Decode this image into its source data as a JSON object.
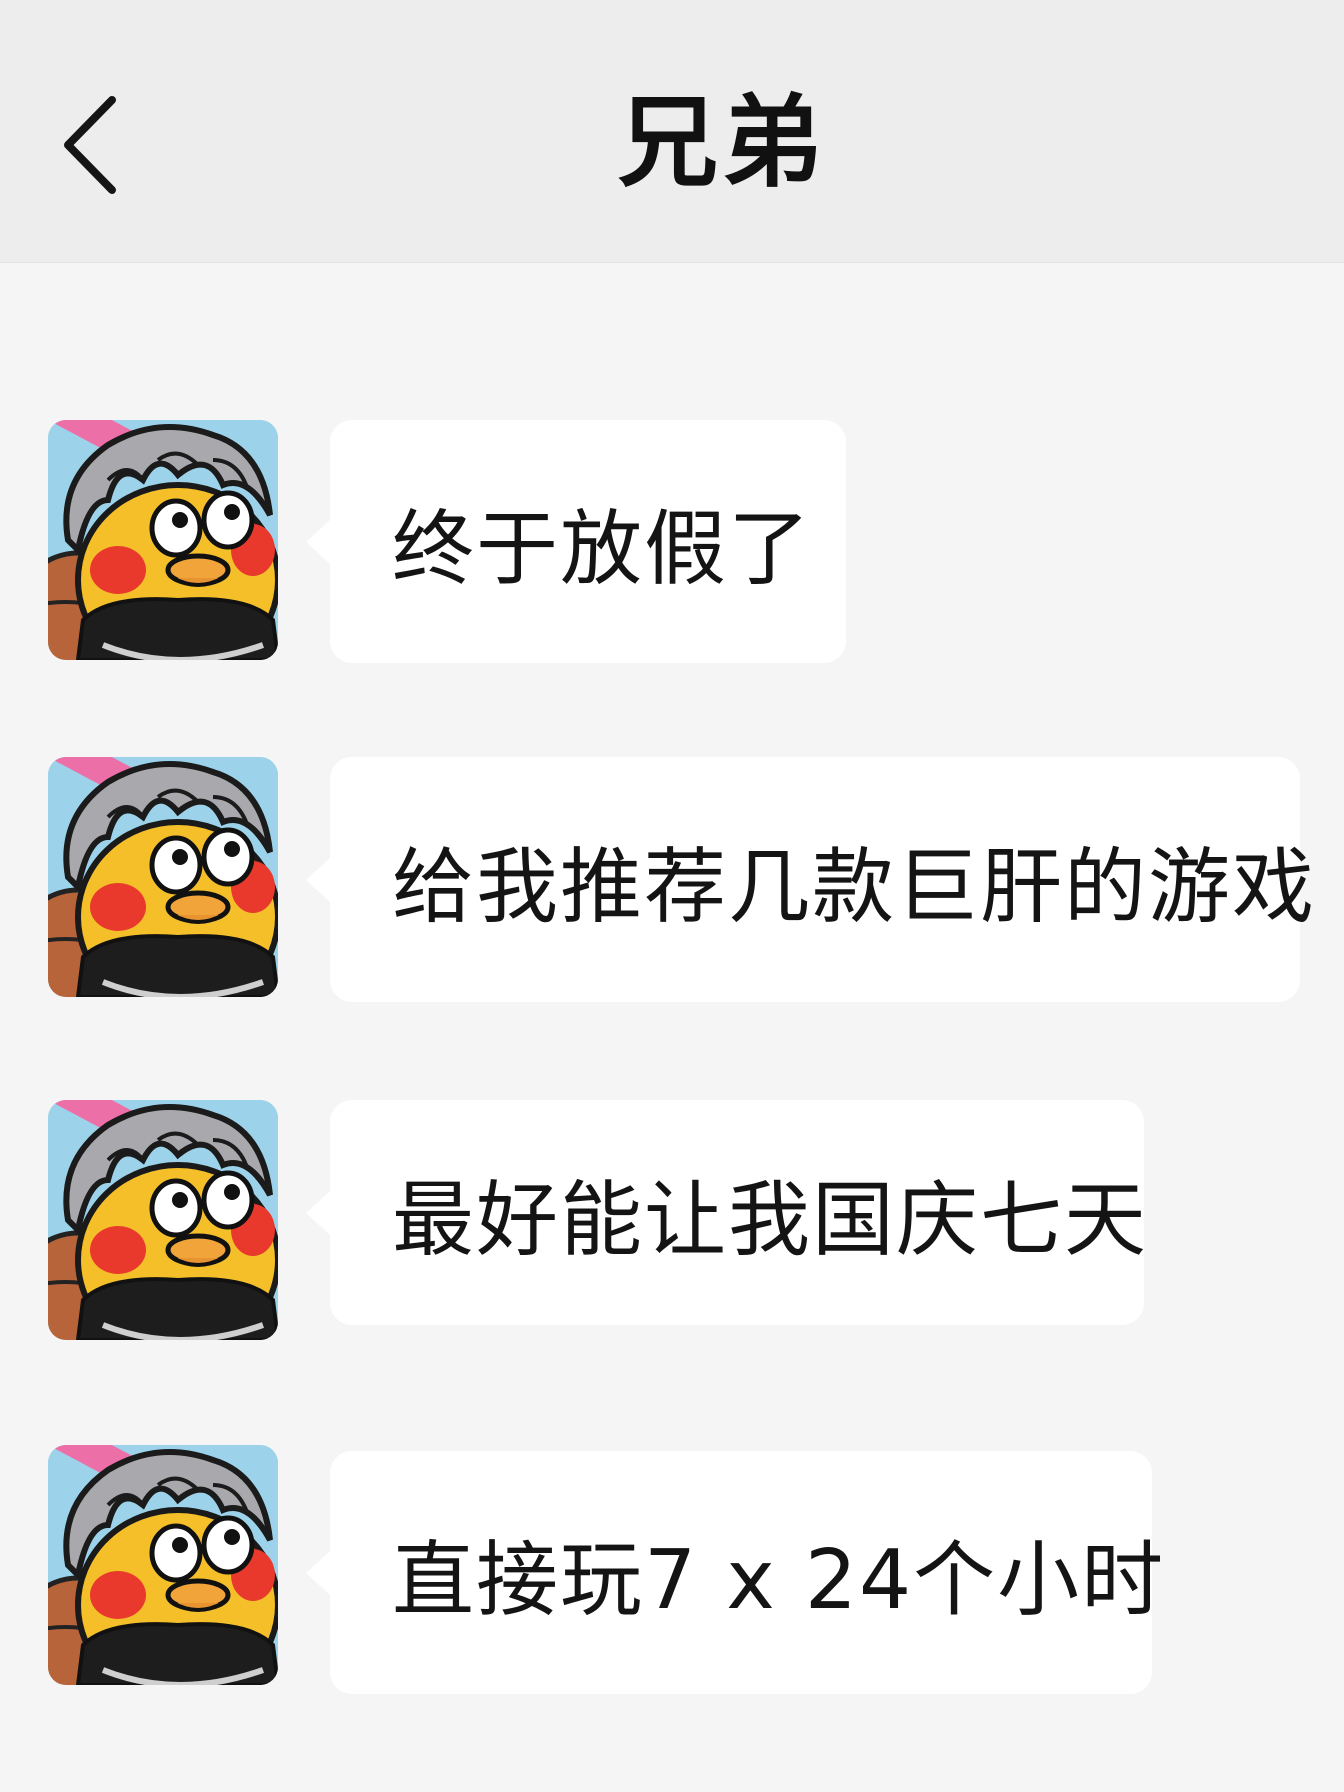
{
  "header": {
    "title": "兄弟",
    "back_icon": "chevron-left-icon"
  },
  "messages": [
    {
      "text": "终于放假了",
      "avatar_icon": "cartoon-chick-avatar"
    },
    {
      "text": "给我推荐几款巨肝的游戏",
      "avatar_icon": "cartoon-chick-avatar"
    },
    {
      "text": "最好能让我国庆七天",
      "avatar_icon": "cartoon-chick-avatar"
    },
    {
      "text": "直接玩7 x 24个小时",
      "avatar_icon": "cartoon-chick-avatar"
    }
  ],
  "colors": {
    "header_bg": "#ededed",
    "chat_bg": "#f5f5f5",
    "bubble_bg": "#ffffff",
    "text": "#141414"
  }
}
